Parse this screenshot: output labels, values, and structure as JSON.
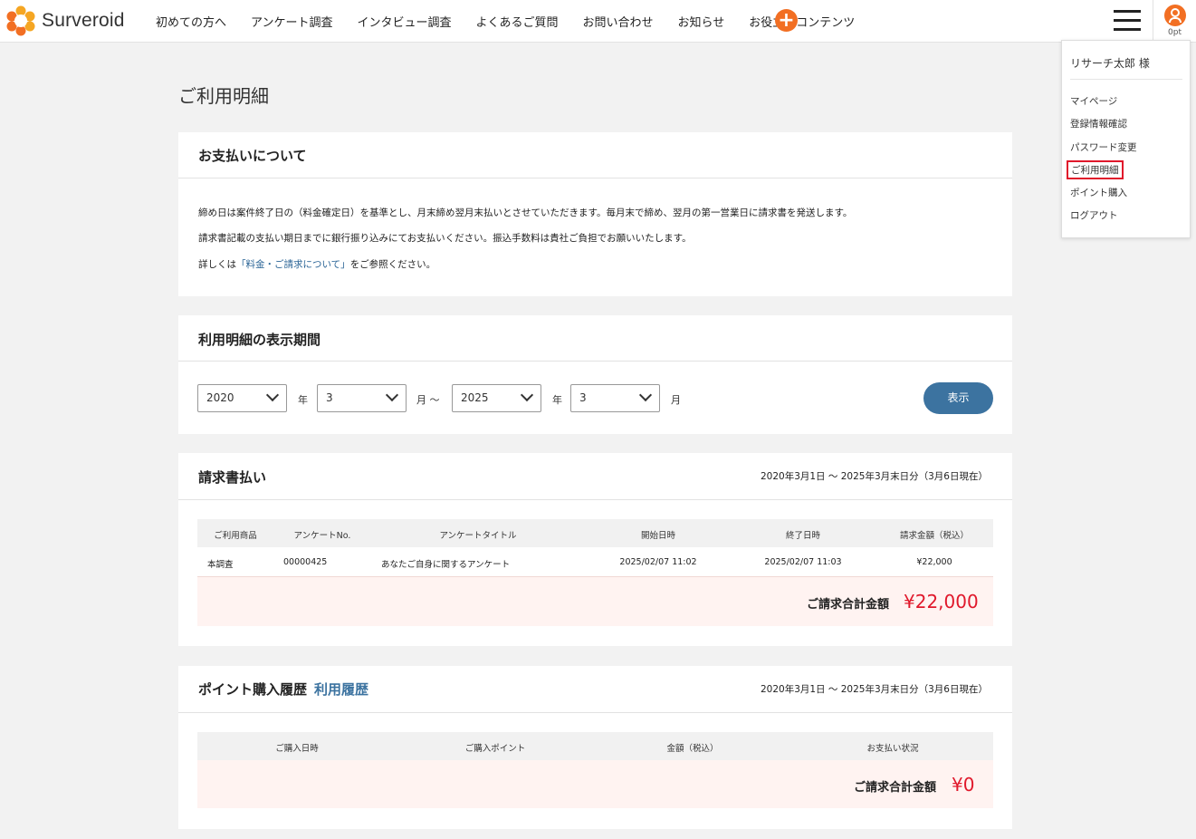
{
  "header": {
    "logo_text": "Surveroid",
    "nav": [
      "初めての方へ",
      "アンケート調査",
      "インタビュー調査",
      "よくあるご質問",
      "お問い合わせ",
      "お知らせ",
      "お役立ちコンテンツ"
    ],
    "plus_label": "+",
    "points": "0pt"
  },
  "menu": {
    "user_name": "リサーチ太郎 様",
    "items": [
      "マイページ",
      "登録情報確認",
      "パスワード変更",
      "ご利用明細",
      "ポイント購入",
      "ログアウト"
    ],
    "active_index": 3
  },
  "page": {
    "title": "ご利用明細"
  },
  "payment_info": {
    "title": "お支払いについて",
    "line1": "締め日は案件終了日の（料金確定日）を基準とし、月末締め翌月末払いとさせていただきます。毎月末で締め、翌月の第一営業日に請求書を発送します。",
    "line2": "請求書記載の支払い期日までに銀行振り込みにてお支払いください。振込手数料は貴社ご負担でお願いいたします。",
    "line3_prefix": "詳しくは",
    "line3_link": "「料金・ご請求について」",
    "line3_suffix": "をご参照ください。"
  },
  "period": {
    "title": "利用明細の表示期間",
    "from_year": "2020",
    "from_month": "3",
    "to_year": "2025",
    "to_month": "3",
    "year_unit": "年",
    "month_unit": "月",
    "separator": "月 〜",
    "show_button": "表示"
  },
  "invoice": {
    "title": "請求書払い",
    "period": "2020年3月1日 〜 2025年3月末日分（3月6日現在）",
    "columns": [
      "ご利用商品",
      "アンケートNo.",
      "アンケートタイトル",
      "開始日時",
      "終了日時",
      "請求金額（税込）"
    ],
    "rows": [
      [
        "本調査",
        "00000425",
        "あなたご自身に関するアンケート",
        "2025/02/07 11:02",
        "2025/02/07 11:03",
        "¥22,000"
      ]
    ],
    "total_label": "ご請求合計金額",
    "total_value": "¥22,000"
  },
  "points": {
    "title": "ポイント購入履歴",
    "sub_link": "利用履歴",
    "period": "2020年3月1日 〜 2025年3月末日分（3月6日現在）",
    "columns": [
      "ご購入日時",
      "ご購入ポイント",
      "金額（税込）",
      "お支払い状況"
    ],
    "total_label": "ご請求合計金額",
    "total_value": "¥0"
  },
  "colors": {
    "brand_orange": "#f26f23",
    "accent_blue": "#3c73a0",
    "total_red": "#e0182b"
  }
}
